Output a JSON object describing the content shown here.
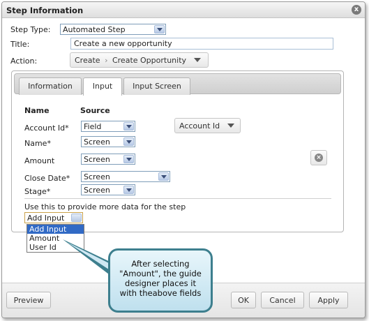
{
  "dialog": {
    "title": "Step Information",
    "close_glyph": "x"
  },
  "form": {
    "step_type_label": "Step Type:",
    "step_type_value": "Automated Step",
    "title_label": "Title:",
    "title_value": "Create a new opportunity",
    "action_label": "Action:",
    "action_part1": "Create",
    "action_separator": "›",
    "action_part2": "Create Opportunity"
  },
  "tabs": [
    {
      "label": "Information"
    },
    {
      "label": "Input"
    },
    {
      "label": "Input Screen"
    }
  ],
  "inputs": {
    "col_name": "Name",
    "col_source": "Source",
    "rows": [
      {
        "name": "Account Id*",
        "source": "Field",
        "extra": "Account Id"
      },
      {
        "name": "Name*",
        "source": "Screen"
      },
      {
        "name": "Amount",
        "source": "Screen"
      },
      {
        "name": "Close Date*",
        "source": "Screen"
      },
      {
        "name": "Stage*",
        "source": "Screen"
      }
    ],
    "hint": "Use this to provide more data for the step",
    "add_input_value": "Add Input",
    "dropdown_options": [
      "Add Input",
      "Amount",
      "User Id"
    ]
  },
  "footer": {
    "preview": "Preview",
    "ok": "OK",
    "cancel": "Cancel",
    "apply": "Apply"
  },
  "callout": {
    "lines": [
      "After selecting",
      "\"Amount\", the guide",
      "designer places it",
      "with theabove fields"
    ]
  },
  "colors": {
    "selected_option": "#316ac5",
    "callout_border": "#3d7f8e",
    "callout_fill": "#cfe8f3"
  }
}
